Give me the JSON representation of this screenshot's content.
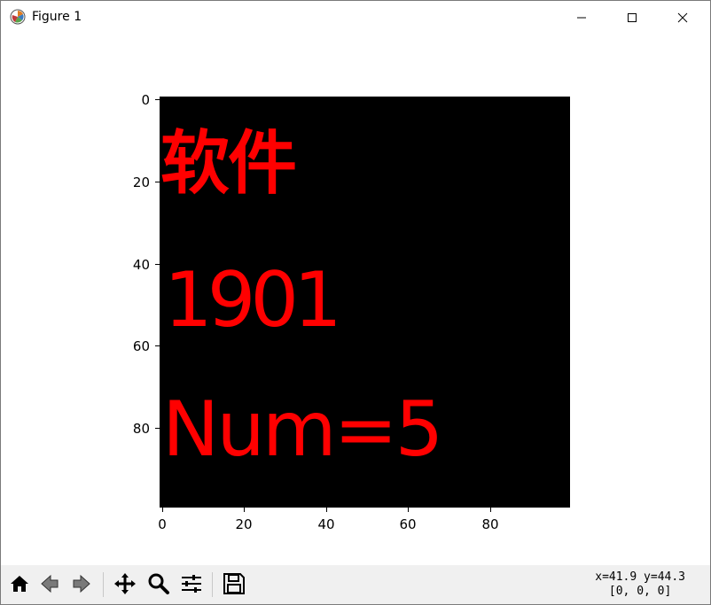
{
  "window": {
    "title": "Figure 1"
  },
  "plot": {
    "image_lines": [
      "软件",
      "1901",
      "Num=5"
    ],
    "text_color": "#ff0000",
    "background_color": "#000000",
    "y_ticks": [
      "0",
      "20",
      "40",
      "60",
      "80"
    ],
    "x_ticks": [
      "0",
      "20",
      "40",
      "60",
      "80"
    ]
  },
  "toolbar": {
    "buttons": [
      "home-icon",
      "back-icon",
      "forward-icon",
      "pan-icon",
      "zoom-icon",
      "configure-subplots-icon",
      "save-icon"
    ],
    "coords_line1": "x=41.9 y=44.3",
    "coords_line2": "[0, 0, 0]"
  }
}
